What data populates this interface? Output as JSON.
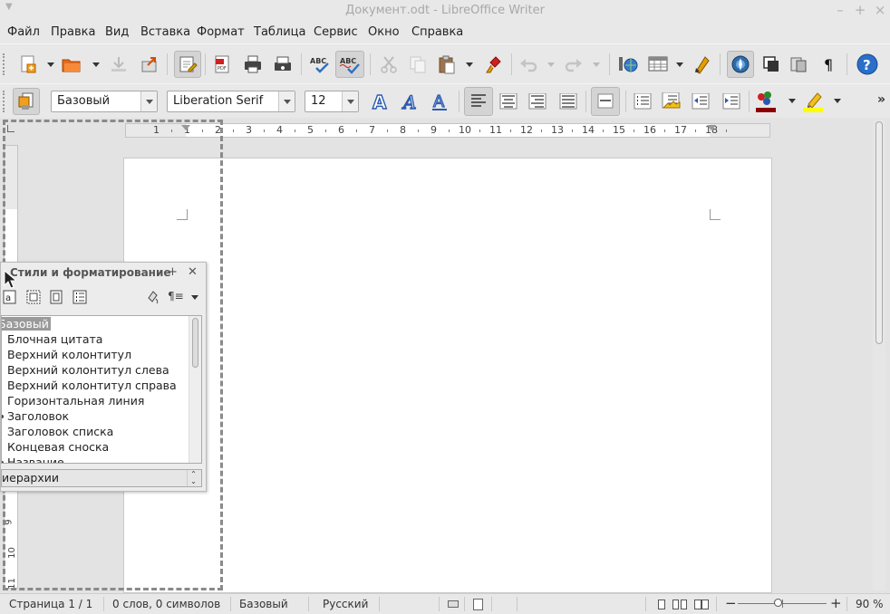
{
  "window": {
    "title": "Документ.odt - LibreOffice Writer",
    "controls": [
      "minimize-icon",
      "maximize-icon",
      "close-icon"
    ]
  },
  "menu": {
    "items": [
      "Файл",
      "Правка",
      "Вид",
      "Вставка",
      "Формат",
      "Таблица",
      "Сервис",
      "Окно",
      "Справка"
    ]
  },
  "formatting": {
    "paragraph_style": "Базовый",
    "font_name": "Liberation Serif",
    "font_size": "12"
  },
  "ruler": {
    "numbers": [
      "1",
      "1",
      "2",
      "3",
      "4",
      "5",
      "6",
      "7",
      "8",
      "9",
      "10",
      "11",
      "12",
      "13",
      "14",
      "15",
      "16",
      "17",
      "18"
    ],
    "vertical_numbers": [
      "1",
      "9",
      "10",
      "11"
    ]
  },
  "styles_panel": {
    "title": "Стили и форматирование",
    "items": [
      "Базовый",
      "Блочная цитата",
      "Верхний колонтитул",
      "Верхний колонтитул слева",
      "Верхний колонтитул справа",
      "Горизонтальная линия",
      "Заголовок",
      "Заголовок списка",
      "Концевая сноска",
      "Название"
    ],
    "selected": "Базовый",
    "filter": "иерархии"
  },
  "status": {
    "page": "Страница 1 / 1",
    "words": "0 слов, 0 символов",
    "style": "Базовый",
    "language": "Русский",
    "zoom": "90 %",
    "zoom_level": 0.9
  },
  "colors": {
    "font_color_bar": "#8b0000",
    "highlight_bar": "#ffff00",
    "help_blue": "#2a6fc9"
  }
}
